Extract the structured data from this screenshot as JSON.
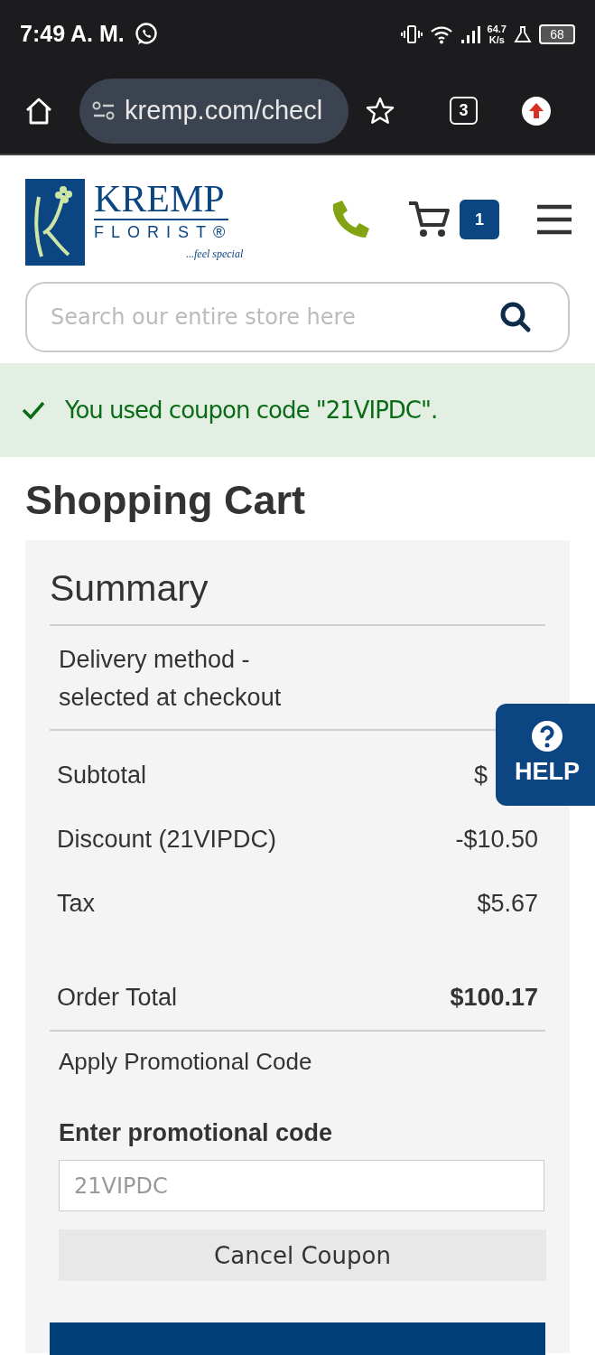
{
  "status_bar": {
    "time": "7:49 A. M.",
    "network_speed": "64.7",
    "network_unit": "K/s",
    "battery": "68"
  },
  "browser": {
    "url": "kremp.com/checl",
    "tab_count": "3"
  },
  "header": {
    "brand": "KREMP",
    "brand_sub": "FLORIST®",
    "tagline": "...feel special",
    "cart_count": "1"
  },
  "search": {
    "placeholder": "Search our entire store here"
  },
  "alert": {
    "kind": "success",
    "message": "You used coupon code \"21VIPDC\"."
  },
  "page_title": "Shopping Cart",
  "summary": {
    "title": "Summary",
    "delivery": "Delivery method - selected at checkout",
    "rows": [
      {
        "label": "Subtotal",
        "value": "$",
        "kind": "covered"
      },
      {
        "label": "Discount (21VIPDC)",
        "value": "-$10.50",
        "kind": "normal"
      },
      {
        "label": "Tax",
        "value": "$5.67",
        "kind": "normal"
      },
      {
        "label": "Order Total",
        "value": "$100.17",
        "kind": "total"
      }
    ],
    "promo_toggle": "Apply Promotional Code",
    "promo_label": "Enter promotional code",
    "promo_value": "21VIPDC",
    "cancel_button": "Cancel Coupon",
    "primary_button": {
      "kind": "button"
    }
  },
  "help": {
    "label": "HELP"
  }
}
